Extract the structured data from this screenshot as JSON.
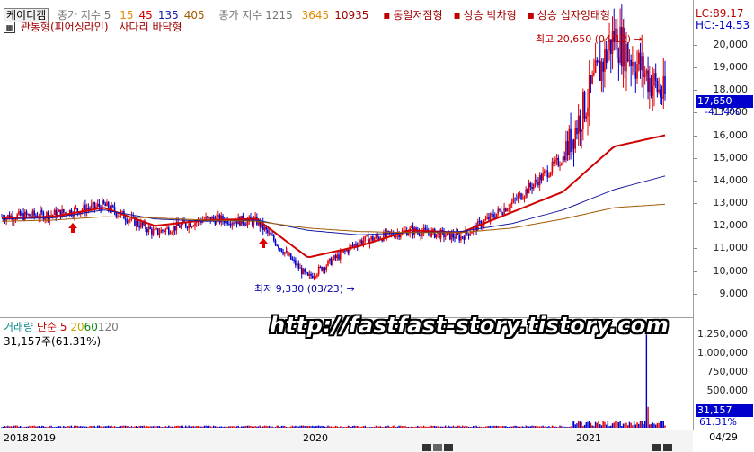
{
  "legend": {
    "ticker": "케이디켐",
    "ma_label": "종가 지수 5",
    "ma_periods": [
      {
        "text": "15",
        "color": "#e38a00"
      },
      {
        "text": "45",
        "color": "#d00000"
      },
      {
        "text": "135",
        "color": "#1a1aa0"
      },
      {
        "text": "405",
        "color": "#a05a00"
      }
    ],
    "ma2_label": "종가 지수 1215",
    "ma2_periods": [
      {
        "text": "3645",
        "color": "#e38a00"
      },
      {
        "text": "10935",
        "color": "#a00000"
      }
    ],
    "patterns": [
      "동일저점형",
      "상승 박차형",
      "상승 십자잉태형",
      "관통형(피어싱라인)",
      "사다리 바닥형"
    ],
    "lc_label": "LC:89.17",
    "hc_label": "HC:-14.53"
  },
  "volume_legend": {
    "label": "거래량",
    "ma_label": "단순 5",
    "periods": [
      {
        "text": "20",
        "color": "#c8a800"
      },
      {
        "text": "60",
        "color": "#0a8a0a"
      },
      {
        "text": "120",
        "color": "#777777"
      }
    ],
    "current": "31,157주(61.31%)"
  },
  "annotations": {
    "high": "최고 20,650 (04/12)",
    "low": "최저 9,330 (03/23)"
  },
  "price_badge": {
    "price": "17,650",
    "change": "-4.34%"
  },
  "volume_badge": {
    "volume": "31,157",
    "pct": "61.31%"
  },
  "watermark": "http://fastfast-story.tistory.com",
  "x_axis": {
    "labels": [
      "2018",
      "2019",
      "2020",
      "2021"
    ],
    "date": "04/29"
  },
  "colors": {
    "up": "#e00000",
    "down": "#0000cc",
    "ma5": "#d00000",
    "ma135": "#1a1aa0",
    "ma405": "#a05a00"
  },
  "chart_data": {
    "type": "line",
    "title": "",
    "xlabel": "",
    "ylabel": "",
    "ylim": [
      8000,
      21500
    ],
    "y_ticks": [
      9000,
      10000,
      11000,
      12000,
      13000,
      14000,
      15000,
      16000,
      17000,
      18000,
      19000,
      20000
    ],
    "x": [
      "2018-11",
      "2019-01",
      "2019-04",
      "2019-07",
      "2019-10",
      "2020-01",
      "2020-03",
      "2020-04",
      "2020-07",
      "2020-10",
      "2021-01",
      "2021-03",
      "2021-04",
      "2021-04-29"
    ],
    "series": [
      {
        "key": "close",
        "values": [
          12400,
          12500,
          12900,
          11700,
          12300,
          12200,
          9700,
          11300,
          11800,
          11500,
          13000,
          15000,
          20400,
          17650
        ]
      },
      {
        "key": "ma45",
        "values": [
          12350,
          12400,
          12800,
          12000,
          12250,
          12300,
          10600,
          11100,
          11800,
          11700,
          12600,
          13500,
          15500,
          16000
        ]
      },
      {
        "key": "ma135",
        "values": [
          12300,
          12350,
          12700,
          12300,
          12200,
          12250,
          11800,
          11600,
          11700,
          11750,
          12100,
          12700,
          13600,
          14200
        ]
      },
      {
        "key": "ma405",
        "values": [
          12200,
          12250,
          12400,
          12350,
          12250,
          12200,
          11900,
          11750,
          11700,
          11700,
          11900,
          12300,
          12800,
          12950
        ]
      }
    ],
    "volume": {
      "ylim": [
        0,
        1350000
      ],
      "y_ticks": [
        250000,
        500000,
        750000,
        1000000,
        1250000
      ],
      "tick_labels": [
        "250,000",
        "500,000",
        "750,000",
        "1,000,000",
        "1,250,000"
      ],
      "spike": 1250000,
      "last": 31157
    },
    "price_tick_labels": [
      "9,000",
      "10,000",
      "11,000",
      "12,000",
      "13,000",
      "14,000",
      "15,000",
      "16,000",
      "17,000",
      "18,000",
      "19,000",
      "20,000"
    ]
  }
}
